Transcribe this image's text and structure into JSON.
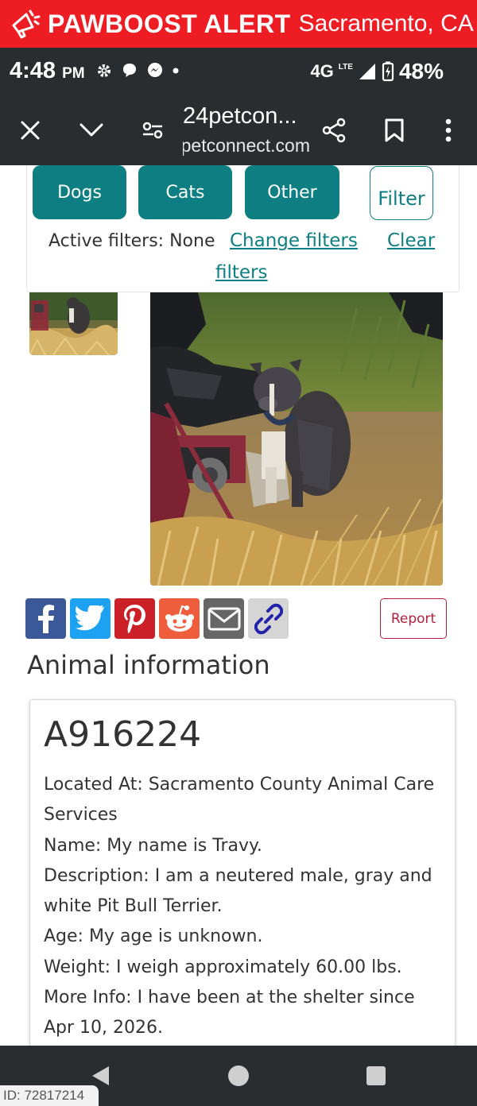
{
  "banner": {
    "brand": "PAWBOOST ALERT",
    "location": "Sacramento, CA",
    "icon": "megaphone-icon",
    "color": "#ee1d24"
  },
  "status": {
    "time": "4:48",
    "ampm": "PM",
    "network": "4G",
    "network_sub": "LTE",
    "battery": "48%"
  },
  "browser": {
    "title": "24petcon...",
    "domain": "24petconnect.com",
    "icons": [
      "close-icon",
      "chevron-down-icon",
      "page-info-icon",
      "share-icon",
      "bookmark-icon",
      "more-vert-icon"
    ]
  },
  "filters": {
    "tabs": [
      "Dogs",
      "Cats",
      "Other"
    ],
    "filter_label": "Filter",
    "active": "Active filters: None",
    "change": "Change filters",
    "clear_a": "Clear",
    "clear_b": "filters"
  },
  "share": {
    "report_label": "Report",
    "buttons": [
      "facebook-icon",
      "twitter-icon",
      "pinterest-icon",
      "reddit-icon",
      "email-icon",
      "link-icon"
    ]
  },
  "animal": {
    "heading": "Animal information",
    "id": "A916224",
    "lines": [
      "Located At: Sacramento County Animal Care Services",
      "Name: My name is Travy.",
      "Description: I am a neutered male, gray and white Pit Bull Terrier.",
      "Age: My age is unknown.",
      "Weight: I weigh approximately 60.00 lbs.",
      "More Info: I have been at the shelter since Apr 10, 2026."
    ]
  },
  "footer": {
    "id_tag": "ID: 72817214"
  },
  "colors": {
    "teal": "#0d7f83",
    "report": "#b5203e",
    "dark": "#2a2d30"
  }
}
